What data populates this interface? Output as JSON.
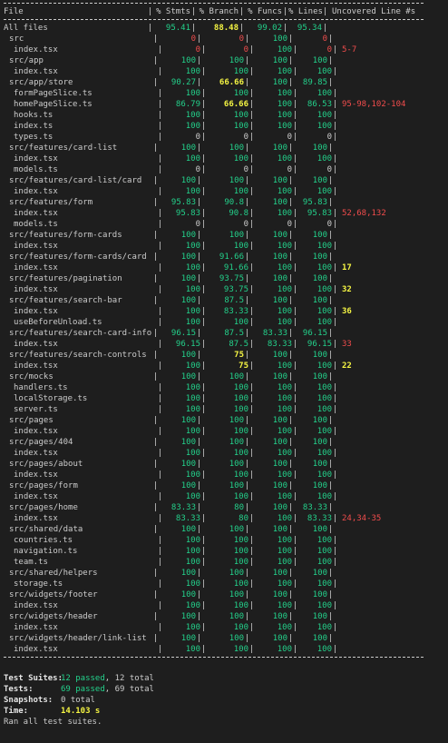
{
  "header": {
    "file": "File",
    "stmts": "% Stmts",
    "branch": "% Branch",
    "funcs": "% Funcs",
    "lines": "% Lines",
    "uncovered": "Uncovered Line #s"
  },
  "rows": [
    {
      "name": "All files",
      "indent": 0,
      "stmts": "95.41",
      "branch": "88.48",
      "funcs": "99.02",
      "lines": "95.34",
      "uncovered": "",
      "color": "green",
      "c": [
        "g",
        "y",
        "g",
        "g"
      ]
    },
    {
      "name": "src",
      "indent": 1,
      "stmts": "0",
      "branch": "0",
      "funcs": "100",
      "lines": "0",
      "uncovered": "",
      "color": "red",
      "c": [
        "r",
        "r",
        "g",
        "r"
      ]
    },
    {
      "name": "index.tsx",
      "indent": 2,
      "stmts": "0",
      "branch": "0",
      "funcs": "100",
      "lines": "0",
      "uncovered": "5-7",
      "color": "red",
      "c": [
        "r",
        "r",
        "g",
        "r"
      ]
    },
    {
      "name": "src/app",
      "indent": 1,
      "stmts": "100",
      "branch": "100",
      "funcs": "100",
      "lines": "100",
      "uncovered": "",
      "color": "green",
      "c": [
        "g",
        "g",
        "g",
        "g"
      ]
    },
    {
      "name": "index.tsx",
      "indent": 2,
      "stmts": "100",
      "branch": "100",
      "funcs": "100",
      "lines": "100",
      "uncovered": "",
      "color": "green",
      "c": [
        "g",
        "g",
        "g",
        "g"
      ]
    },
    {
      "name": "src/app/store",
      "indent": 1,
      "stmts": "90.27",
      "branch": "66.66",
      "funcs": "100",
      "lines": "89.85",
      "uncovered": "",
      "color": "green",
      "c": [
        "g",
        "y",
        "g",
        "g"
      ]
    },
    {
      "name": "formPageSlice.ts",
      "indent": 2,
      "stmts": "100",
      "branch": "100",
      "funcs": "100",
      "lines": "100",
      "uncovered": "",
      "color": "green",
      "c": [
        "g",
        "g",
        "g",
        "g"
      ]
    },
    {
      "name": "homePageSlice.ts",
      "indent": 2,
      "stmts": "86.79",
      "branch": "66.66",
      "funcs": "100",
      "lines": "86.53",
      "uncovered": "95-98,102-104",
      "color": "green",
      "c": [
        "g",
        "y",
        "g",
        "g"
      ]
    },
    {
      "name": "hooks.ts",
      "indent": 2,
      "stmts": "100",
      "branch": "100",
      "funcs": "100",
      "lines": "100",
      "uncovered": "",
      "color": "green",
      "c": [
        "g",
        "g",
        "g",
        "g"
      ]
    },
    {
      "name": "index.ts",
      "indent": 2,
      "stmts": "100",
      "branch": "100",
      "funcs": "100",
      "lines": "100",
      "uncovered": "",
      "color": "green",
      "c": [
        "g",
        "g",
        "g",
        "g"
      ]
    },
    {
      "name": "types.ts",
      "indent": 2,
      "stmts": "0",
      "branch": "0",
      "funcs": "0",
      "lines": "0",
      "uncovered": "",
      "color": "white",
      "c": [
        "w",
        "w",
        "w",
        "w"
      ]
    },
    {
      "name": "src/features/card-list",
      "indent": 1,
      "stmts": "100",
      "branch": "100",
      "funcs": "100",
      "lines": "100",
      "uncovered": "",
      "color": "green",
      "c": [
        "g",
        "g",
        "g",
        "g"
      ]
    },
    {
      "name": "index.tsx",
      "indent": 2,
      "stmts": "100",
      "branch": "100",
      "funcs": "100",
      "lines": "100",
      "uncovered": "",
      "color": "green",
      "c": [
        "g",
        "g",
        "g",
        "g"
      ]
    },
    {
      "name": "models.ts",
      "indent": 2,
      "stmts": "0",
      "branch": "0",
      "funcs": "0",
      "lines": "0",
      "uncovered": "",
      "color": "white",
      "c": [
        "w",
        "w",
        "w",
        "w"
      ]
    },
    {
      "name": "src/features/card-list/card",
      "indent": 1,
      "stmts": "100",
      "branch": "100",
      "funcs": "100",
      "lines": "100",
      "uncovered": "",
      "color": "green",
      "c": [
        "g",
        "g",
        "g",
        "g"
      ]
    },
    {
      "name": "index.tsx",
      "indent": 2,
      "stmts": "100",
      "branch": "100",
      "funcs": "100",
      "lines": "100",
      "uncovered": "",
      "color": "green",
      "c": [
        "g",
        "g",
        "g",
        "g"
      ]
    },
    {
      "name": "src/features/form",
      "indent": 1,
      "stmts": "95.83",
      "branch": "90.8",
      "funcs": "100",
      "lines": "95.83",
      "uncovered": "",
      "color": "green",
      "c": [
        "g",
        "g",
        "g",
        "g"
      ]
    },
    {
      "name": "index.tsx",
      "indent": 2,
      "stmts": "95.83",
      "branch": "90.8",
      "funcs": "100",
      "lines": "95.83",
      "uncovered": "52,68,132",
      "color": "green",
      "c": [
        "g",
        "g",
        "g",
        "g"
      ]
    },
    {
      "name": "models.ts",
      "indent": 2,
      "stmts": "0",
      "branch": "0",
      "funcs": "0",
      "lines": "0",
      "uncovered": "",
      "color": "white",
      "c": [
        "w",
        "w",
        "w",
        "w"
      ]
    },
    {
      "name": "src/features/form-cards",
      "indent": 1,
      "stmts": "100",
      "branch": "100",
      "funcs": "100",
      "lines": "100",
      "uncovered": "",
      "color": "green",
      "c": [
        "g",
        "g",
        "g",
        "g"
      ]
    },
    {
      "name": "index.tsx",
      "indent": 2,
      "stmts": "100",
      "branch": "100",
      "funcs": "100",
      "lines": "100",
      "uncovered": "",
      "color": "green",
      "c": [
        "g",
        "g",
        "g",
        "g"
      ]
    },
    {
      "name": "src/features/form-cards/card",
      "indent": 1,
      "stmts": "100",
      "branch": "91.66",
      "funcs": "100",
      "lines": "100",
      "uncovered": "",
      "color": "green",
      "c": [
        "g",
        "g",
        "g",
        "g"
      ]
    },
    {
      "name": "index.tsx",
      "indent": 2,
      "stmts": "100",
      "branch": "91.66",
      "funcs": "100",
      "lines": "100",
      "uncovered": "17",
      "color": "green",
      "c": [
        "g",
        "g",
        "g",
        "g"
      ],
      "uncColor": "yellow"
    },
    {
      "name": "src/features/pagination",
      "indent": 1,
      "stmts": "100",
      "branch": "93.75",
      "funcs": "100",
      "lines": "100",
      "uncovered": "",
      "color": "green",
      "c": [
        "g",
        "g",
        "g",
        "g"
      ]
    },
    {
      "name": "index.tsx",
      "indent": 2,
      "stmts": "100",
      "branch": "93.75",
      "funcs": "100",
      "lines": "100",
      "uncovered": "32",
      "color": "green",
      "c": [
        "g",
        "g",
        "g",
        "g"
      ],
      "uncColor": "yellow"
    },
    {
      "name": "src/features/search-bar",
      "indent": 1,
      "stmts": "100",
      "branch": "87.5",
      "funcs": "100",
      "lines": "100",
      "uncovered": "",
      "color": "green",
      "c": [
        "g",
        "g",
        "g",
        "g"
      ]
    },
    {
      "name": "index.tsx",
      "indent": 2,
      "stmts": "100",
      "branch": "83.33",
      "funcs": "100",
      "lines": "100",
      "uncovered": "36",
      "color": "green",
      "c": [
        "g",
        "g",
        "g",
        "g"
      ],
      "uncColor": "yellow"
    },
    {
      "name": "useBeforeUnload.ts",
      "indent": 2,
      "stmts": "100",
      "branch": "100",
      "funcs": "100",
      "lines": "100",
      "uncovered": "",
      "color": "green",
      "c": [
        "g",
        "g",
        "g",
        "g"
      ]
    },
    {
      "name": "src/features/search-card-info",
      "indent": 1,
      "stmts": "96.15",
      "branch": "87.5",
      "funcs": "83.33",
      "lines": "96.15",
      "uncovered": "",
      "color": "green",
      "c": [
        "g",
        "g",
        "g",
        "g"
      ]
    },
    {
      "name": "index.tsx",
      "indent": 2,
      "stmts": "96.15",
      "branch": "87.5",
      "funcs": "83.33",
      "lines": "96.15",
      "uncovered": "33",
      "color": "green",
      "c": [
        "g",
        "g",
        "g",
        "g"
      ],
      "uncColor": "red"
    },
    {
      "name": "src/features/search-controls",
      "indent": 1,
      "stmts": "100",
      "branch": "75",
      "funcs": "100",
      "lines": "100",
      "uncovered": "",
      "color": "green",
      "c": [
        "g",
        "y",
        "g",
        "g"
      ]
    },
    {
      "name": "index.tsx",
      "indent": 2,
      "stmts": "100",
      "branch": "75",
      "funcs": "100",
      "lines": "100",
      "uncovered": "22",
      "color": "green",
      "c": [
        "g",
        "y",
        "g",
        "g"
      ],
      "uncColor": "yellow"
    },
    {
      "name": "src/mocks",
      "indent": 1,
      "stmts": "100",
      "branch": "100",
      "funcs": "100",
      "lines": "100",
      "uncovered": "",
      "color": "green",
      "c": [
        "g",
        "g",
        "g",
        "g"
      ]
    },
    {
      "name": "handlers.ts",
      "indent": 2,
      "stmts": "100",
      "branch": "100",
      "funcs": "100",
      "lines": "100",
      "uncovered": "",
      "color": "green",
      "c": [
        "g",
        "g",
        "g",
        "g"
      ]
    },
    {
      "name": "localStorage.ts",
      "indent": 2,
      "stmts": "100",
      "branch": "100",
      "funcs": "100",
      "lines": "100",
      "uncovered": "",
      "color": "green",
      "c": [
        "g",
        "g",
        "g",
        "g"
      ]
    },
    {
      "name": "server.ts",
      "indent": 2,
      "stmts": "100",
      "branch": "100",
      "funcs": "100",
      "lines": "100",
      "uncovered": "",
      "color": "green",
      "c": [
        "g",
        "g",
        "g",
        "g"
      ]
    },
    {
      "name": "src/pages",
      "indent": 1,
      "stmts": "100",
      "branch": "100",
      "funcs": "100",
      "lines": "100",
      "uncovered": "",
      "color": "green",
      "c": [
        "g",
        "g",
        "g",
        "g"
      ]
    },
    {
      "name": "index.tsx",
      "indent": 2,
      "stmts": "100",
      "branch": "100",
      "funcs": "100",
      "lines": "100",
      "uncovered": "",
      "color": "green",
      "c": [
        "g",
        "g",
        "g",
        "g"
      ]
    },
    {
      "name": "src/pages/404",
      "indent": 1,
      "stmts": "100",
      "branch": "100",
      "funcs": "100",
      "lines": "100",
      "uncovered": "",
      "color": "green",
      "c": [
        "g",
        "g",
        "g",
        "g"
      ]
    },
    {
      "name": "index.tsx",
      "indent": 2,
      "stmts": "100",
      "branch": "100",
      "funcs": "100",
      "lines": "100",
      "uncovered": "",
      "color": "green",
      "c": [
        "g",
        "g",
        "g",
        "g"
      ]
    },
    {
      "name": "src/pages/about",
      "indent": 1,
      "stmts": "100",
      "branch": "100",
      "funcs": "100",
      "lines": "100",
      "uncovered": "",
      "color": "green",
      "c": [
        "g",
        "g",
        "g",
        "g"
      ]
    },
    {
      "name": "index.tsx",
      "indent": 2,
      "stmts": "100",
      "branch": "100",
      "funcs": "100",
      "lines": "100",
      "uncovered": "",
      "color": "green",
      "c": [
        "g",
        "g",
        "g",
        "g"
      ]
    },
    {
      "name": "src/pages/form",
      "indent": 1,
      "stmts": "100",
      "branch": "100",
      "funcs": "100",
      "lines": "100",
      "uncovered": "",
      "color": "green",
      "c": [
        "g",
        "g",
        "g",
        "g"
      ]
    },
    {
      "name": "index.tsx",
      "indent": 2,
      "stmts": "100",
      "branch": "100",
      "funcs": "100",
      "lines": "100",
      "uncovered": "",
      "color": "green",
      "c": [
        "g",
        "g",
        "g",
        "g"
      ]
    },
    {
      "name": "src/pages/home",
      "indent": 1,
      "stmts": "83.33",
      "branch": "80",
      "funcs": "100",
      "lines": "83.33",
      "uncovered": "",
      "color": "green",
      "c": [
        "g",
        "g",
        "g",
        "g"
      ]
    },
    {
      "name": "index.tsx",
      "indent": 2,
      "stmts": "83.33",
      "branch": "80",
      "funcs": "100",
      "lines": "83.33",
      "uncovered": "24,34-35",
      "color": "green",
      "c": [
        "g",
        "g",
        "g",
        "g"
      ],
      "uncColor": "red"
    },
    {
      "name": "src/shared/data",
      "indent": 1,
      "stmts": "100",
      "branch": "100",
      "funcs": "100",
      "lines": "100",
      "uncovered": "",
      "color": "green",
      "c": [
        "g",
        "g",
        "g",
        "g"
      ]
    },
    {
      "name": "countries.ts",
      "indent": 2,
      "stmts": "100",
      "branch": "100",
      "funcs": "100",
      "lines": "100",
      "uncovered": "",
      "color": "green",
      "c": [
        "g",
        "g",
        "g",
        "g"
      ]
    },
    {
      "name": "navigation.ts",
      "indent": 2,
      "stmts": "100",
      "branch": "100",
      "funcs": "100",
      "lines": "100",
      "uncovered": "",
      "color": "green",
      "c": [
        "g",
        "g",
        "g",
        "g"
      ]
    },
    {
      "name": "team.ts",
      "indent": 2,
      "stmts": "100",
      "branch": "100",
      "funcs": "100",
      "lines": "100",
      "uncovered": "",
      "color": "green",
      "c": [
        "g",
        "g",
        "g",
        "g"
      ]
    },
    {
      "name": "src/shared/helpers",
      "indent": 1,
      "stmts": "100",
      "branch": "100",
      "funcs": "100",
      "lines": "100",
      "uncovered": "",
      "color": "green",
      "c": [
        "g",
        "g",
        "g",
        "g"
      ]
    },
    {
      "name": "storage.ts",
      "indent": 2,
      "stmts": "100",
      "branch": "100",
      "funcs": "100",
      "lines": "100",
      "uncovered": "",
      "color": "green",
      "c": [
        "g",
        "g",
        "g",
        "g"
      ]
    },
    {
      "name": "src/widgets/footer",
      "indent": 1,
      "stmts": "100",
      "branch": "100",
      "funcs": "100",
      "lines": "100",
      "uncovered": "",
      "color": "green",
      "c": [
        "g",
        "g",
        "g",
        "g"
      ]
    },
    {
      "name": "index.tsx",
      "indent": 2,
      "stmts": "100",
      "branch": "100",
      "funcs": "100",
      "lines": "100",
      "uncovered": "",
      "color": "green",
      "c": [
        "g",
        "g",
        "g",
        "g"
      ]
    },
    {
      "name": "src/widgets/header",
      "indent": 1,
      "stmts": "100",
      "branch": "100",
      "funcs": "100",
      "lines": "100",
      "uncovered": "",
      "color": "green",
      "c": [
        "g",
        "g",
        "g",
        "g"
      ]
    },
    {
      "name": "index.tsx",
      "indent": 2,
      "stmts": "100",
      "branch": "100",
      "funcs": "100",
      "lines": "100",
      "uncovered": "",
      "color": "green",
      "c": [
        "g",
        "g",
        "g",
        "g"
      ]
    },
    {
      "name": "src/widgets/header/link-list",
      "indent": 1,
      "stmts": "100",
      "branch": "100",
      "funcs": "100",
      "lines": "100",
      "uncovered": "",
      "color": "green",
      "c": [
        "g",
        "g",
        "g",
        "g"
      ]
    },
    {
      "name": "index.tsx",
      "indent": 2,
      "stmts": "100",
      "branch": "100",
      "funcs": "100",
      "lines": "100",
      "uncovered": "",
      "color": "green",
      "c": [
        "g",
        "g",
        "g",
        "g"
      ]
    }
  ],
  "summary": {
    "suites_label": "Test Suites:",
    "suites_passed": "12 passed",
    "suites_total": ", 12 total",
    "tests_label": "Tests:",
    "tests_passed": "69 passed",
    "tests_total": ", 69 total",
    "snapshots_label": "Snapshots:",
    "snapshots_value": "0 total",
    "time_label": "Time:",
    "time_value": "14.103 s",
    "ran": "Ran all test suites."
  },
  "colors": {
    "background": "#1e1e1e",
    "green": "#23d18b",
    "red": "#f14c4c",
    "yellow": "#f5f543",
    "text": "#cccccc"
  }
}
